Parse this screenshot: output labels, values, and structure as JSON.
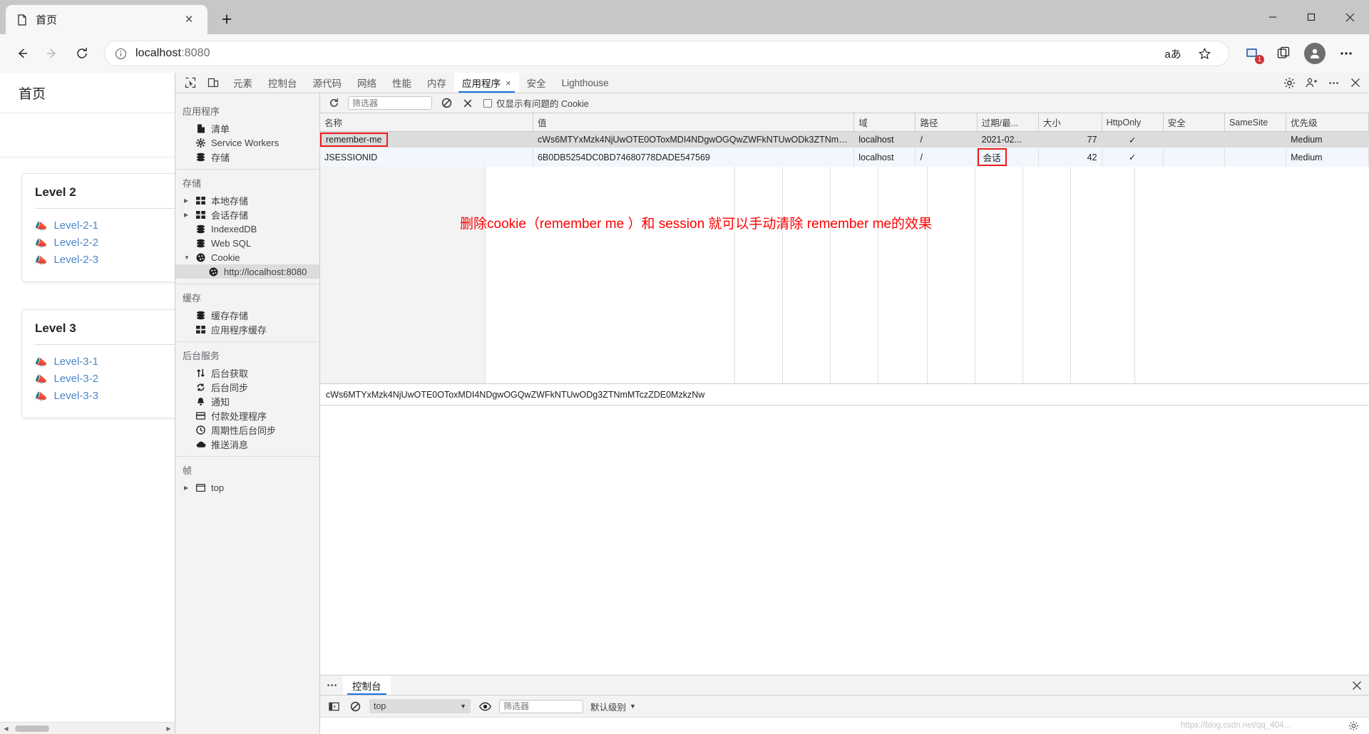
{
  "browser": {
    "tab": {
      "title": "首页",
      "favicon": "page-icon",
      "close": "×"
    },
    "new_tab": "+",
    "window_controls": {
      "minimize": "–",
      "maximize": "□",
      "close": "✕"
    },
    "nav": {
      "back": "←",
      "forward": "→",
      "reload": "⟳"
    },
    "omnibox": {
      "info_icon": "info-icon",
      "url_host": "localhost",
      "url_port": ":8080",
      "read_aloud": "aあ",
      "favorite": "☆",
      "collections_badge": "1"
    }
  },
  "webpage": {
    "header_title": "首页",
    "cards": [
      {
        "title": "Level 2",
        "links": [
          "Level-2-1",
          "Level-2-2",
          "Level-2-3"
        ]
      },
      {
        "title": "Level 3",
        "links": [
          "Level-3-1",
          "Level-3-2",
          "Level-3-3"
        ]
      }
    ]
  },
  "devtools": {
    "tabs": [
      {
        "label": "元素",
        "active": false
      },
      {
        "label": "控制台",
        "active": false
      },
      {
        "label": "源代码",
        "active": false
      },
      {
        "label": "网络",
        "active": false
      },
      {
        "label": "性能",
        "active": false
      },
      {
        "label": "内存",
        "active": false
      },
      {
        "label": "应用程序",
        "active": true,
        "closable": "×"
      },
      {
        "label": "安全",
        "active": false
      },
      {
        "label": "Lighthouse",
        "active": false
      }
    ],
    "right_icons": [
      "settings-gear-icon",
      "devtools-customize-icon",
      "more-options-icon",
      "close-icon"
    ],
    "sidebar": {
      "groups": [
        {
          "title": "应用程序",
          "items": [
            {
              "label": "清单",
              "icon": "manifest-icon",
              "twisty": ""
            },
            {
              "label": "Service Workers",
              "icon": "gear-icon",
              "twisty": ""
            },
            {
              "label": "存储",
              "icon": "database-icon",
              "twisty": ""
            }
          ]
        },
        {
          "title": "存储",
          "items": [
            {
              "label": "本地存储",
              "icon": "table-icon",
              "twisty": "▶"
            },
            {
              "label": "会话存储",
              "icon": "table-icon",
              "twisty": "▶"
            },
            {
              "label": "IndexedDB",
              "icon": "database-icon",
              "twisty": ""
            },
            {
              "label": "Web SQL",
              "icon": "database-icon",
              "twisty": ""
            },
            {
              "label": "Cookie",
              "icon": "cookie-icon",
              "twisty": "▼"
            },
            {
              "label": "http://localhost:8080",
              "icon": "cookie-icon",
              "twisty": "",
              "indent": 2,
              "selected": true
            }
          ]
        },
        {
          "title": "缓存",
          "items": [
            {
              "label": "缓存存储",
              "icon": "database-icon",
              "twisty": ""
            },
            {
              "label": "应用程序缓存",
              "icon": "table-icon",
              "twisty": ""
            }
          ]
        },
        {
          "title": "后台服务",
          "items": [
            {
              "label": "后台获取",
              "icon": "arrows-updown-icon",
              "twisty": ""
            },
            {
              "label": "后台同步",
              "icon": "sync-icon",
              "twisty": ""
            },
            {
              "label": "通知",
              "icon": "bell-icon",
              "twisty": ""
            },
            {
              "label": "付款处理程序",
              "icon": "card-icon",
              "twisty": ""
            },
            {
              "label": "周期性后台同步",
              "icon": "clock-icon",
              "twisty": ""
            },
            {
              "label": "推送消息",
              "icon": "cloud-icon",
              "twisty": ""
            }
          ]
        },
        {
          "title": "帧",
          "items": [
            {
              "label": "top",
              "icon": "frame-icon",
              "twisty": "▶"
            }
          ]
        }
      ]
    },
    "cookie_panel": {
      "toolbar": {
        "refresh_icon": "refresh-icon",
        "filter_placeholder": "筛选器",
        "clear_all_icon": "clear-all-cookies-icon",
        "delete_icon": "delete-selected-icon",
        "checkbox_label": "仅显示有问题的 Cookie"
      },
      "columns": [
        "名称",
        "值",
        "域",
        "路径",
        "过期/最...",
        "大小",
        "HttpOnly",
        "安全",
        "SameSite",
        "优先级"
      ],
      "rows": [
        {
          "name": "remember-me",
          "value": "cWs6MTYxMzk4NjUwOTE0OToxMDI4NDgwOGQwZWFkNTUwODk3ZTNmMTczZDE0MzkzNw...",
          "value_display": "cWs6MTYxMzk4NjUwOTE0OToxMDI4NDgwOGQwZWFkNTUwODk3ZTNmMTczZDE0MzkzNw...",
          "domain": "localhost",
          "path": "/",
          "expires": "2021-02...",
          "size": "77",
          "httponly": "✓",
          "secure": "",
          "samesite": "",
          "priority": "Medium",
          "selected": true,
          "name_highlighted": true
        },
        {
          "name": "JSESSIONID",
          "value": "6B0DB5254DC0BD74680778DADE547569",
          "value_display": "6B0DB5254DC0BD74680778DADE547569",
          "domain": "localhost",
          "path": "/",
          "expires": "会话",
          "size": "42",
          "httponly": "✓",
          "secure": "",
          "samesite": "",
          "priority": "Medium",
          "selected": false,
          "expires_highlighted": true
        }
      ],
      "annotation": "删除cookie（remember me ）和 session 就可以手动清除 remember me的效果",
      "annotation_color": "#ff0000",
      "value_preview": "cWs6MTYxMzk4NjUwOTE0OToxMDI4NDgwOGQwZWFkNTUwODg3ZTNmMTczZDE0MzkzNw"
    },
    "drawer": {
      "more_icon": "more-tools-icon",
      "tab_label": "控制台",
      "close_icon": "close-icon",
      "console_toolbar": {
        "sidebar_toggle_icon": "console-sidebar-icon",
        "clear_icon": "clear-console-icon",
        "context": "top",
        "context_caret": "▼",
        "eye_icon": "live-expression-icon",
        "filter_placeholder": "筛选器",
        "level": "默认级别",
        "level_caret": "▼"
      },
      "watermark": "https://blog.csdn.net/qq_404...",
      "settings_icon": "settings-gear-icon"
    }
  }
}
